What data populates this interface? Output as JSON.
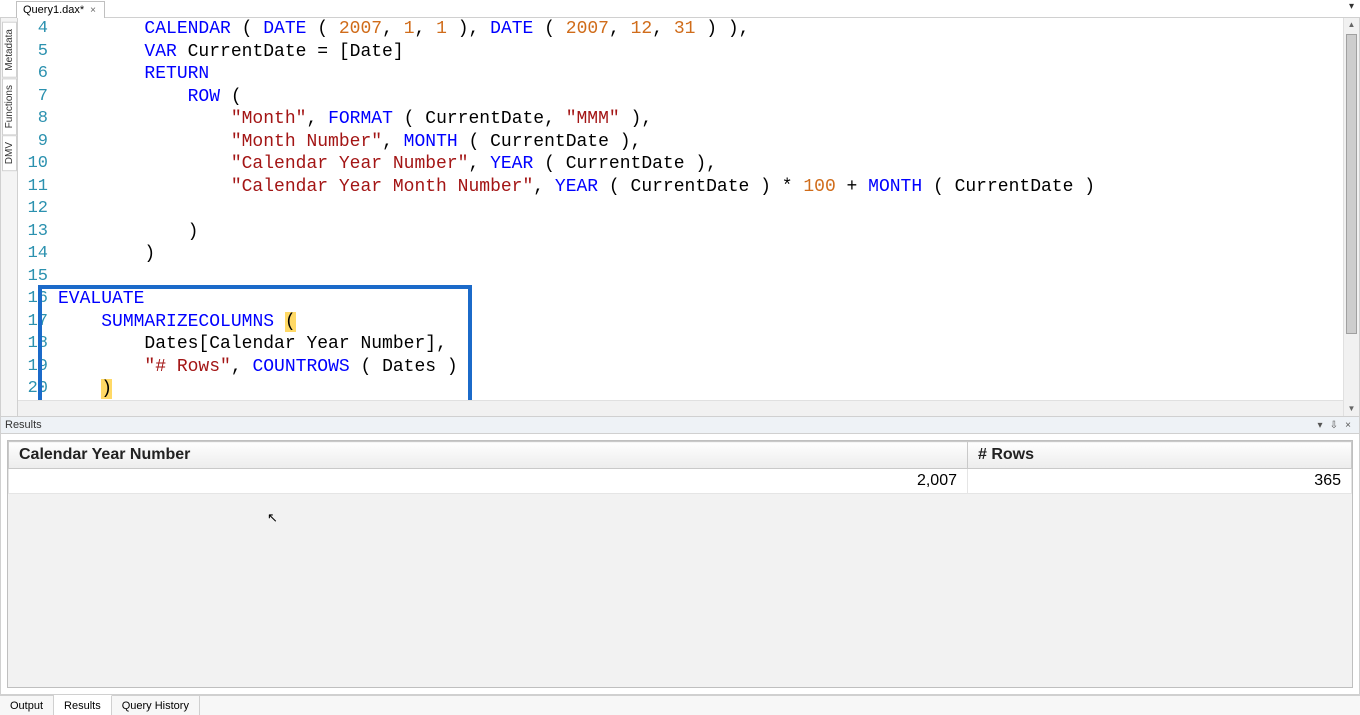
{
  "tab": {
    "label": "Query1.dax*",
    "close_glyph": "×"
  },
  "tabstrip_more_glyph": "▾",
  "side_tabs": {
    "metadata": "Metadata",
    "functions": "Functions",
    "dmv": "DMV"
  },
  "editor": {
    "lines": [
      {
        "n": 4
      },
      {
        "n": 5
      },
      {
        "n": 6
      },
      {
        "n": 7
      },
      {
        "n": 8
      },
      {
        "n": 9
      },
      {
        "n": 10
      },
      {
        "n": 11
      },
      {
        "n": 12
      },
      {
        "n": 13
      },
      {
        "n": 14
      },
      {
        "n": 15
      },
      {
        "n": 16
      },
      {
        "n": 17
      },
      {
        "n": 18
      },
      {
        "n": 19
      },
      {
        "n": 20
      }
    ],
    "t4": {
      "fn1": "CALENDAR",
      "op1": " ( ",
      "fn2": "DATE",
      "op2": " ( ",
      "n1": "2007",
      "c1": ", ",
      "n2": "1",
      "c2": ", ",
      "n3": "1",
      "op3": " ), ",
      "fn3": "DATE",
      "op4": " ( ",
      "n4": "2007",
      "c3": ", ",
      "n5": "12",
      "c4": ", ",
      "n6": "31",
      "op5": " ) ),"
    },
    "t5": {
      "kw": "VAR",
      "rest": " CurrentDate = [Date]"
    },
    "t6": {
      "kw": "RETURN"
    },
    "t7": {
      "fn": "ROW",
      "rest": " ("
    },
    "t8": {
      "s": "\"Month\"",
      "c": ", ",
      "fn": "FORMAT",
      "op": " ( CurrentDate, ",
      "s2": "\"MMM\"",
      "op2": " ),"
    },
    "t9": {
      "s": "\"Month Number\"",
      "c": ", ",
      "fn": "MONTH",
      "op": " ( CurrentDate ),"
    },
    "t10": {
      "s": "\"Calendar Year Number\"",
      "c": ", ",
      "fn": "YEAR",
      "op": " ( CurrentDate ),"
    },
    "t11": {
      "s": "\"Calendar Year Month Number\"",
      "c": ", ",
      "fn": "YEAR",
      "op": " ( CurrentDate ) * ",
      "n": "100",
      "op2": " + ",
      "fn2": "MONTH",
      "op3": " ( CurrentDate )"
    },
    "t12": {
      "a": ""
    },
    "t13": {
      "a": ")"
    },
    "t14": {
      "a": ")"
    },
    "t15": {
      "a": ""
    },
    "t16": {
      "kw": "EVALUATE"
    },
    "t17": {
      "fn": "SUMMARIZECOLUMNS",
      "sp": " ",
      "hl": "("
    },
    "t18": {
      "a": "Dates[Calendar Year Number],"
    },
    "t19": {
      "s": "\"# Rows\"",
      "c": ", ",
      "fn": "COUNTROWS",
      "op": " ( Dates )"
    },
    "t20": {
      "hl": ")"
    }
  },
  "results": {
    "title": "Results",
    "ctrl_down": "▾",
    "ctrl_pin": "⇩",
    "ctrl_close": "×",
    "columns": {
      "c1": "Calendar Year Number",
      "c2": "# Rows"
    },
    "rows": [
      {
        "c1": "2,007",
        "c2": "365"
      }
    ]
  },
  "bottom_tabs": {
    "output": "Output",
    "results": "Results",
    "history": "Query History"
  },
  "scroll_up": "▲",
  "scroll_down": "▼",
  "cursor_glyph": "↖"
}
